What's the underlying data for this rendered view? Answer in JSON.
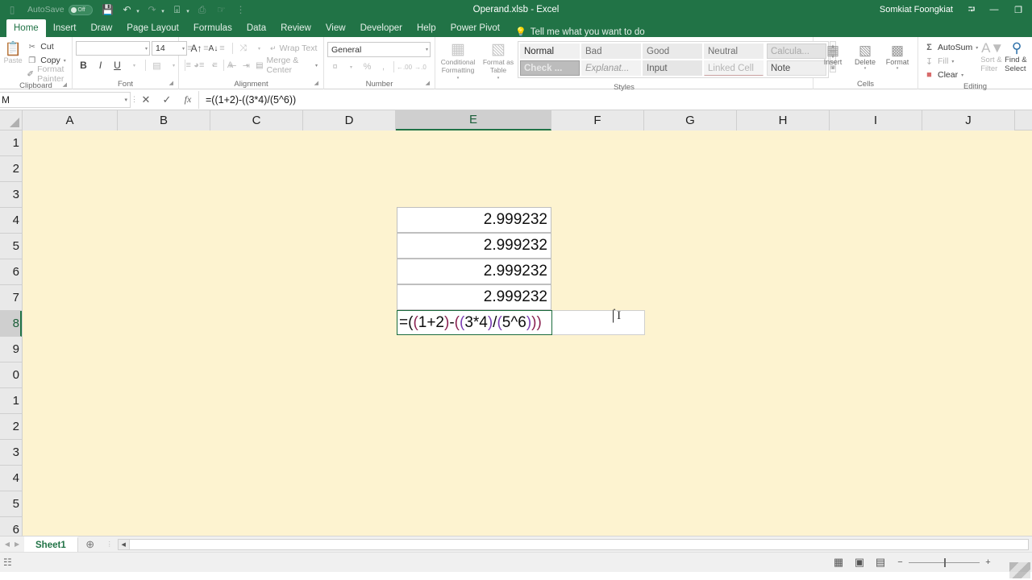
{
  "titlebar": {
    "autosave_label": "AutoSave",
    "autosave_state": "Off",
    "document_title": "Operand.xlsb  -  Excel",
    "username": "Somkiat Foongkiat",
    "quick_access": [
      {
        "name": "file-icon",
        "glyph": "▭"
      },
      {
        "name": "save-icon",
        "glyph": "💾"
      },
      {
        "name": "undo-icon",
        "glyph": "↶"
      },
      {
        "name": "redo-icon",
        "glyph": "↷"
      },
      {
        "name": "layout-icon",
        "glyph": "⌸"
      },
      {
        "name": "print-preview-icon",
        "glyph": "⌕"
      },
      {
        "name": "touch-mode-icon",
        "glyph": "☝"
      },
      {
        "name": "customize-qat-icon",
        "glyph": "☰"
      }
    ],
    "window_buttons": [
      {
        "name": "ribbon-display-options",
        "glyph": "⬒"
      },
      {
        "name": "minimize-button",
        "glyph": "—"
      },
      {
        "name": "restore-button",
        "glyph": "❐"
      }
    ]
  },
  "tabs": [
    {
      "label": "Home",
      "active": true
    },
    {
      "label": "Insert",
      "active": false
    },
    {
      "label": "Draw",
      "active": false
    },
    {
      "label": "Page Layout",
      "active": false
    },
    {
      "label": "Formulas",
      "active": false
    },
    {
      "label": "Data",
      "active": false
    },
    {
      "label": "Review",
      "active": false
    },
    {
      "label": "View",
      "active": false
    },
    {
      "label": "Developer",
      "active": false
    },
    {
      "label": "Help",
      "active": false
    },
    {
      "label": "Power Pivot",
      "active": false
    }
  ],
  "tellme": "Tell me what you want to do",
  "ribbon": {
    "clipboard": {
      "label": "Clipboard",
      "paste_label": "Paste",
      "items": [
        {
          "label": "Cut",
          "icon": "✂",
          "disabled": false
        },
        {
          "label": "Copy",
          "icon": "❐",
          "disabled": false
        },
        {
          "label": "Format Painter",
          "icon": "✐",
          "disabled": true
        }
      ]
    },
    "font": {
      "label": "Font",
      "font_name": "",
      "font_name_placeholder": "",
      "font_size": "14",
      "buttons": [
        {
          "name": "increase-font-size",
          "glyph": "A"
        },
        {
          "name": "decrease-font-size",
          "glyph": "A"
        },
        {
          "name": "bold",
          "glyph": "B"
        },
        {
          "name": "italic",
          "glyph": "I"
        },
        {
          "name": "underline",
          "glyph": "U"
        },
        {
          "name": "borders",
          "glyph": "⊞"
        },
        {
          "name": "fill-color",
          "glyph": "◑"
        },
        {
          "name": "font-color",
          "glyph": "A"
        }
      ]
    },
    "alignment": {
      "label": "Alignment",
      "wrap_text": "Wrap Text",
      "merge_center": "Merge & Center",
      "buttons": [
        {
          "name": "align-top",
          "glyph": "≡"
        },
        {
          "name": "align-middle",
          "glyph": "≡"
        },
        {
          "name": "align-bottom",
          "glyph": "≡"
        },
        {
          "name": "orientation",
          "glyph": "⤨"
        },
        {
          "name": "align-left",
          "glyph": "≡"
        },
        {
          "name": "align-center",
          "glyph": "≡"
        },
        {
          "name": "align-right",
          "glyph": "≡"
        },
        {
          "name": "decrease-indent",
          "glyph": "⇤"
        },
        {
          "name": "increase-indent",
          "glyph": "⇥"
        }
      ]
    },
    "number": {
      "label": "Number",
      "format": "General",
      "buttons": [
        {
          "name": "accounting-format",
          "glyph": "¤"
        },
        {
          "name": "percent-style",
          "glyph": "%"
        },
        {
          "name": "comma-style",
          "glyph": ","
        },
        {
          "name": "increase-decimal",
          "glyph": "·₀₀"
        },
        {
          "name": "decrease-decimal",
          "glyph": "·₀₀"
        }
      ]
    },
    "styles": {
      "label": "Styles",
      "conditional_formatting": "Conditional Formatting",
      "format_as_table": "Format as Table",
      "gallery": [
        {
          "label": "Normal",
          "cls": "normal"
        },
        {
          "label": "Bad",
          "cls": "bad"
        },
        {
          "label": "Good",
          "cls": "good"
        },
        {
          "label": "Neutral",
          "cls": "neutral"
        },
        {
          "label": "Calcula...",
          "cls": "calc"
        },
        {
          "label": "Check ...",
          "cls": "check"
        },
        {
          "label": "Explanat...",
          "cls": "expl"
        },
        {
          "label": "Input",
          "cls": "input"
        },
        {
          "label": "Linked Cell",
          "cls": "linked"
        },
        {
          "label": "Note",
          "cls": "note"
        }
      ]
    },
    "cells": {
      "label": "Cells",
      "items": [
        {
          "label": "Insert",
          "icon": "⊞"
        },
        {
          "label": "Delete",
          "icon": "⊟"
        },
        {
          "label": "Format",
          "icon": "▦"
        }
      ]
    },
    "editing": {
      "label": "Editing",
      "autosum": "AutoSum",
      "fill": "Fill",
      "clear": "Clear",
      "sort_filter": "Sort & Filter",
      "find_select": "Find & Select"
    }
  },
  "formulabar": {
    "name_box": "M",
    "cancel_icon": "✕",
    "enter_icon": "✓",
    "fx_label": "fx",
    "formula": "=((1+2)-((3*4)/(5^6))"
  },
  "grid": {
    "columns": [
      "A",
      "B",
      "C",
      "D",
      "E",
      "F",
      "G",
      "H",
      "I",
      "J"
    ],
    "selected_column": "E",
    "rows": [
      "1",
      "2",
      "3",
      "4",
      "5",
      "6",
      "7",
      "8",
      "9",
      "0",
      "1",
      "2",
      "3",
      "4",
      "5",
      "6"
    ],
    "selected_row_index": 7,
    "cells": [
      {
        "value": "2.999232",
        "row": 3
      },
      {
        "value": "2.999232",
        "row": 4
      },
      {
        "value": "2.999232",
        "row": 5
      },
      {
        "value": "2.999232",
        "row": 6
      }
    ],
    "editing_cell": {
      "tokens": [
        {
          "text": "=(",
          "color": "blk"
        },
        {
          "text": "(",
          "color": "red"
        },
        {
          "text": "1+2",
          "color": "blk"
        },
        {
          "text": ")",
          "color": "red"
        },
        {
          "text": "-",
          "color": "blk"
        },
        {
          "text": "(",
          "color": "red"
        },
        {
          "text": "(",
          "color": "pur"
        },
        {
          "text": "3*4",
          "color": "blk"
        },
        {
          "text": ")",
          "color": "pur"
        },
        {
          "text": "/",
          "color": "blk"
        },
        {
          "text": "(",
          "color": "pur"
        },
        {
          "text": "5^6",
          "color": "blk"
        },
        {
          "text": ")",
          "color": "pur"
        },
        {
          "text": ")",
          "color": "red"
        },
        {
          "text": ")",
          "color": "red"
        }
      ],
      "plain_text": "=((1+2)-((3*4)/(5^6)))"
    }
  },
  "sheetbar": {
    "tabs": [
      "Sheet1"
    ],
    "add_sheet_icon": "⊕"
  },
  "statusbar": {
    "mode_icon": "☷",
    "views": [
      {
        "name": "normal-view",
        "glyph": "▦"
      },
      {
        "name": "page-layout-view",
        "glyph": "▣"
      },
      {
        "name": "page-break-view",
        "glyph": "▤"
      }
    ],
    "zoom_out": "−",
    "zoom_in": "+",
    "zoom_level": ""
  },
  "colors": {
    "excel_green": "#217346",
    "sheet_background": "#fdf3d0",
    "paren_red": "#8b2252",
    "paren_purple": "#7d3fb5"
  }
}
